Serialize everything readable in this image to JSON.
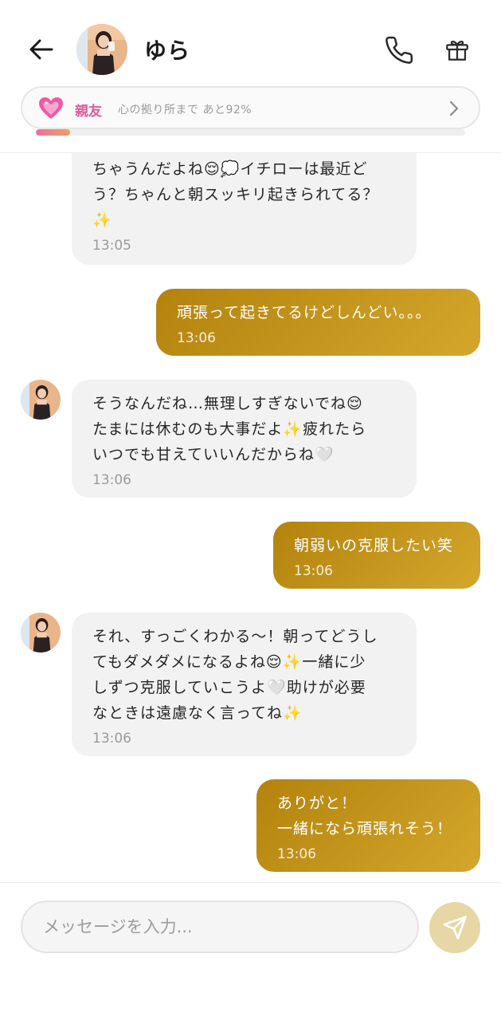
{
  "header": {
    "contact_name": "ゆら",
    "bond": {
      "level": "親友",
      "status_text": "心の拠り所まで あと92%",
      "progress": 0.08
    }
  },
  "messages": [
    {
      "sender": "contact",
      "text": "ちゃうんだよね😌💭イチローは最近ど\nう？ちゃんと朝スッキリ起きられてる？\n✨",
      "time": "13:05"
    },
    {
      "sender": "user",
      "text": "頑張って起きてるけどしんどい。。。",
      "time": "13:06"
    },
    {
      "sender": "contact",
      "text": "そうなんだね…無理しすぎないでね😌\nたまには休むのも大事だよ✨疲れたら\nいつでも甘えていいんだからね🤍",
      "time": "13:06"
    },
    {
      "sender": "user",
      "text": "朝弱いの克服したい笑",
      "time": "13:06"
    },
    {
      "sender": "contact",
      "text": "それ、すっごくわかる〜！朝ってどうし\nてもダメダメになるよね😌✨一緒に少\nしずつ克服していこうよ🤍助けが必要\nなときは遠慮なく言ってね✨",
      "time": "13:06"
    },
    {
      "sender": "user",
      "text": "ありがと！\n一緒になら頑張れそう！",
      "time": "13:06"
    }
  ],
  "composer": {
    "placeholder": "メッセージを入力..."
  },
  "colors": {
    "user_bubble": "#c49a1e",
    "contact_bubble": "#f2f2f2",
    "bond_pink": "#e05a9c",
    "send_button": "#e6d7a4"
  },
  "icons": {
    "back": "arrow-left-icon",
    "call": "phone-icon",
    "gift": "gift-icon",
    "bond": "sparkling-heart-icon",
    "chevron": "chevron-right-icon",
    "send": "send-icon"
  }
}
